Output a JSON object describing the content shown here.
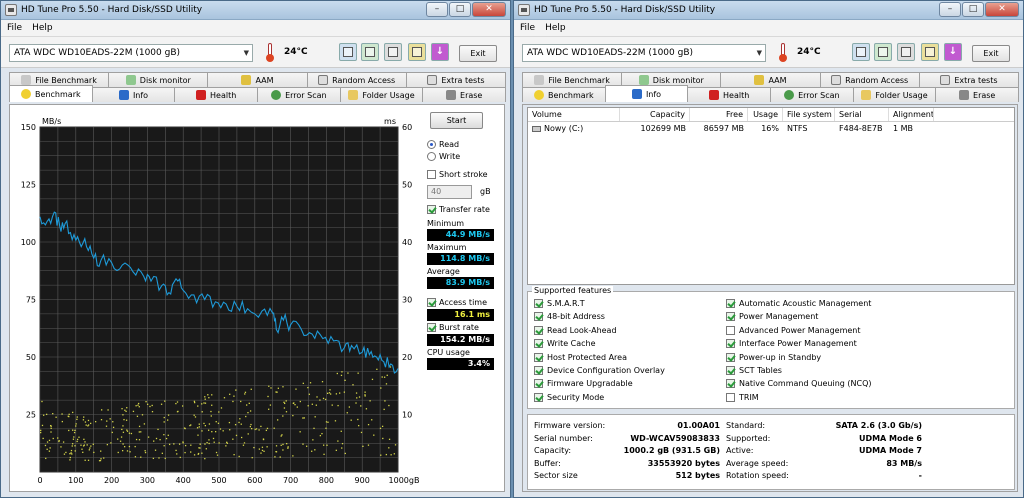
{
  "app_title": "HD Tune Pro 5.50 - Hard Disk/SSD Utility",
  "menu": [
    "File",
    "Help"
  ],
  "drive": "ATA    WDC WD10EADS-22M (1000 gB)",
  "temperature": "24°C",
  "exit_label": "Exit",
  "tabs_row1": [
    "File Benchmark",
    "Disk monitor",
    "AAM",
    "Random Access",
    "Extra tests"
  ],
  "tabs_row2": [
    "Benchmark",
    "Info",
    "Health",
    "Error Scan",
    "Folder Usage",
    "Erase"
  ],
  "colors": {
    "chart_bg": "#191919",
    "transfer": "#1e9ad8",
    "access": "#d4d44a",
    "grid": "#5a5a5a"
  },
  "benchmark": {
    "start_label": "Start",
    "read_label": "Read",
    "write_label": "Write",
    "short_stroke_label": "Short stroke",
    "short_stroke_value": "40",
    "gb_label": "gB",
    "transfer_rate_label": "Transfer rate",
    "minimum_label": "Minimum",
    "minimum_value": "44.9 MB/s",
    "maximum_label": "Maximum",
    "maximum_value": "114.8 MB/s",
    "average_label": "Average",
    "average_value": "83.9 MB/s",
    "access_time_label": "Access time",
    "access_time_value": "16.1 ms",
    "burst_rate_label": "Burst rate",
    "burst_rate_value": "154.2 MB/s",
    "cpu_usage_label": "CPU usage",
    "cpu_usage_value": "3.4%"
  },
  "chart_data": {
    "type": "line",
    "xlabel": "gB",
    "ylabel": "MB/s",
    "y2label": "ms",
    "xlim": [
      0,
      1000
    ],
    "ylim": [
      0,
      150
    ],
    "y2lim": [
      0,
      60
    ],
    "x_ticks": [
      "0",
      "100",
      "200",
      "300",
      "400",
      "500",
      "600",
      "700",
      "800",
      "900",
      "1000gB"
    ],
    "y_ticks": [
      "150",
      "125",
      "100",
      "75",
      "50",
      "25"
    ],
    "y2_ticks": [
      "60",
      "50",
      "40",
      "30",
      "20",
      "10"
    ],
    "series": [
      {
        "values": [
          [
            0,
            111
          ],
          [
            20,
            109
          ],
          [
            40,
            113
          ],
          [
            55,
            107
          ],
          [
            70,
            108
          ],
          [
            90,
            101
          ],
          [
            110,
            100
          ],
          [
            130,
            98
          ],
          [
            150,
            93
          ],
          [
            170,
            92
          ],
          [
            200,
            91
          ],
          [
            230,
            90
          ],
          [
            260,
            87
          ],
          [
            290,
            85
          ],
          [
            310,
            83
          ],
          [
            340,
            81
          ],
          [
            360,
            78
          ],
          [
            380,
            84
          ],
          [
            400,
            79
          ],
          [
            430,
            77
          ],
          [
            460,
            75
          ],
          [
            490,
            74
          ],
          [
            520,
            73
          ],
          [
            550,
            72
          ],
          [
            580,
            71
          ],
          [
            620,
            70
          ],
          [
            650,
            69
          ],
          [
            660,
            62
          ],
          [
            680,
            66
          ],
          [
            700,
            64
          ],
          [
            730,
            62
          ],
          [
            760,
            60
          ],
          [
            790,
            58
          ],
          [
            820,
            57
          ],
          [
            850,
            54
          ],
          [
            870,
            55
          ],
          [
            900,
            52
          ],
          [
            920,
            51
          ],
          [
            940,
            50
          ],
          [
            960,
            48
          ],
          [
            980,
            47
          ],
          [
            1000,
            45
          ]
        ]
      },
      {
        "values": [
          [
            0,
            45
          ],
          [
            100,
            36
          ],
          [
            200,
            40
          ],
          [
            300,
            44
          ],
          [
            400,
            46
          ],
          [
            500,
            50
          ],
          [
            600,
            54
          ],
          [
            700,
            58
          ],
          [
            800,
            62
          ],
          [
            900,
            66
          ],
          [
            1000,
            68
          ]
        ],
        "note_y_axis": "MB/s-equivalent scale of ms axis"
      }
    ]
  },
  "info": {
    "columns": [
      "Volume",
      "Capacity",
      "Free",
      "Usage",
      "File system",
      "Serial",
      "Alignment"
    ],
    "rows": [
      [
        "Nowy (C:)",
        "102699 MB",
        "86597 MB",
        "16%",
        "NTFS",
        "F484-8E7B",
        "1 MB"
      ]
    ],
    "features_title": "Supported features",
    "features_left": [
      {
        "label": "S.M.A.R.T",
        "on": true
      },
      {
        "label": "48-bit Address",
        "on": true
      },
      {
        "label": "Read Look-Ahead",
        "on": true
      },
      {
        "label": "Write Cache",
        "on": true
      },
      {
        "label": "Host Protected Area",
        "on": true
      },
      {
        "label": "Device Configuration Overlay",
        "on": true
      },
      {
        "label": "Firmware Upgradable",
        "on": true
      },
      {
        "label": "Security Mode",
        "on": true
      }
    ],
    "features_right": [
      {
        "label": "Automatic Acoustic Management",
        "on": true
      },
      {
        "label": "Power Management",
        "on": true
      },
      {
        "label": "Advanced Power Management",
        "on": false
      },
      {
        "label": "Interface Power Management",
        "on": true
      },
      {
        "label": "Power-up in Standby",
        "on": true
      },
      {
        "label": "SCT Tables",
        "on": true
      },
      {
        "label": "Native Command Queuing (NCQ)",
        "on": true
      },
      {
        "label": "TRIM",
        "on": false
      }
    ],
    "specs_left": [
      [
        "Firmware version:",
        "01.00A01"
      ],
      [
        "Serial number:",
        "WD-WCAV59083833"
      ],
      [
        "Capacity:",
        "1000.2 gB (931.5 GB)"
      ],
      [
        "Buffer:",
        "33553920 bytes"
      ],
      [
        "Sector size",
        "512 bytes"
      ]
    ],
    "specs_right": [
      [
        "Standard:",
        "SATA 2.6 (3.0 Gb/s)"
      ],
      [
        "Supported:",
        "UDMA Mode 6"
      ],
      [
        "Active:",
        "UDMA Mode 7"
      ],
      [
        "Average speed:",
        "83 MB/s"
      ],
      [
        "Rotation speed:",
        "-"
      ]
    ]
  }
}
